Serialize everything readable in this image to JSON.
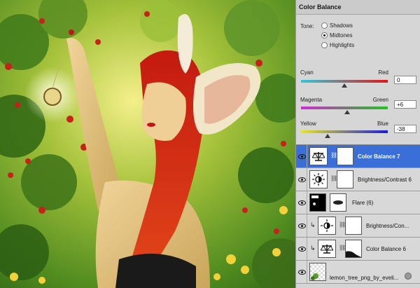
{
  "color_balance": {
    "title": "Color Balance",
    "tone_label": "Tone:",
    "tones": [
      {
        "label": "Shadows",
        "selected": false
      },
      {
        "label": "Midtones",
        "selected": true
      },
      {
        "label": "Highlights",
        "selected": false
      }
    ],
    "sliders": [
      {
        "left": "Cyan",
        "right": "Red",
        "value": "0",
        "level": 0,
        "left_color": "#33c7d9",
        "right_color": "#e01818"
      },
      {
        "left": "Magenta",
        "right": "Green",
        "value": "+6",
        "level": 6,
        "left_color": "#d02bd0",
        "right_color": "#22c322"
      },
      {
        "left": "Yellow",
        "right": "Blue",
        "value": "-38",
        "level": -38,
        "left_color": "#e8e61a",
        "right_color": "#1a1ae0"
      }
    ]
  },
  "layers": [
    {
      "name": "Color Balance 7",
      "active": true,
      "type": "adjustment",
      "icon": "scales-icon",
      "clipped": false
    },
    {
      "name": "Brightness/Contrast 6",
      "active": false,
      "type": "adjustment",
      "icon": "sun-icon",
      "clipped": false
    },
    {
      "name": "Flare (6)",
      "active": false,
      "type": "image",
      "icon": "flare-thumbnail",
      "clipped": false
    },
    {
      "name": "Brightness/Con...",
      "active": false,
      "type": "adjustment",
      "icon": "sun-icon",
      "clipped": true
    },
    {
      "name": "Color Balance 6",
      "active": false,
      "type": "adjustment",
      "icon": "scales-icon",
      "clipped": true
    },
    {
      "name": "lemon_tree_png_by_eveli...",
      "active": false,
      "type": "image",
      "icon": "tree-thumbnail",
      "clipped": false
    }
  ]
}
